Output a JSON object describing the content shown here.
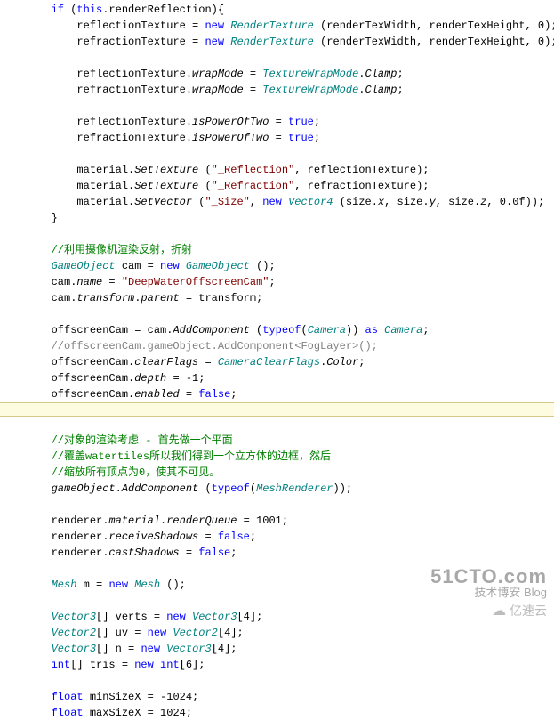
{
  "code": {
    "lines": [
      {
        "indent": 2,
        "tokens": [
          {
            "t": "kw",
            "v": "if"
          },
          {
            "t": "id",
            "v": " ("
          },
          {
            "t": "kw",
            "v": "this"
          },
          {
            "t": "id",
            "v": ".renderReflection){"
          }
        ]
      },
      {
        "indent": 3,
        "tokens": [
          {
            "t": "id",
            "v": "reflectionTexture = "
          },
          {
            "t": "kw",
            "v": "new"
          },
          {
            "t": "id",
            "v": " "
          },
          {
            "t": "type",
            "v": "RenderTexture"
          },
          {
            "t": "id",
            "v": " (renderTexWidth, renderTexHeight, 0);"
          }
        ]
      },
      {
        "indent": 3,
        "tokens": [
          {
            "t": "id",
            "v": "refractionTexture = "
          },
          {
            "t": "kw",
            "v": "new"
          },
          {
            "t": "id",
            "v": " "
          },
          {
            "t": "type",
            "v": "RenderTexture"
          },
          {
            "t": "id",
            "v": " (renderTexWidth, renderTexHeight, 0);"
          }
        ]
      },
      {
        "indent": 0,
        "tokens": []
      },
      {
        "indent": 3,
        "tokens": [
          {
            "t": "id",
            "v": "reflectionTexture."
          },
          {
            "t": "prop",
            "v": "wrapMode"
          },
          {
            "t": "id",
            "v": " = "
          },
          {
            "t": "type",
            "v": "TextureWrapMode"
          },
          {
            "t": "id",
            "v": "."
          },
          {
            "t": "prop",
            "v": "Clamp"
          },
          {
            "t": "id",
            "v": ";"
          }
        ]
      },
      {
        "indent": 3,
        "tokens": [
          {
            "t": "id",
            "v": "refractionTexture."
          },
          {
            "t": "prop",
            "v": "wrapMode"
          },
          {
            "t": "id",
            "v": " = "
          },
          {
            "t": "type",
            "v": "TextureWrapMode"
          },
          {
            "t": "id",
            "v": "."
          },
          {
            "t": "prop",
            "v": "Clamp"
          },
          {
            "t": "id",
            "v": ";"
          }
        ]
      },
      {
        "indent": 0,
        "tokens": []
      },
      {
        "indent": 3,
        "tokens": [
          {
            "t": "id",
            "v": "reflectionTexture."
          },
          {
            "t": "prop",
            "v": "isPowerOfTwo"
          },
          {
            "t": "id",
            "v": " = "
          },
          {
            "t": "kw",
            "v": "true"
          },
          {
            "t": "id",
            "v": ";"
          }
        ]
      },
      {
        "indent": 3,
        "tokens": [
          {
            "t": "id",
            "v": "refractionTexture."
          },
          {
            "t": "prop",
            "v": "isPowerOfTwo"
          },
          {
            "t": "id",
            "v": " = "
          },
          {
            "t": "kw",
            "v": "true"
          },
          {
            "t": "id",
            "v": ";"
          }
        ]
      },
      {
        "indent": 0,
        "tokens": []
      },
      {
        "indent": 3,
        "tokens": [
          {
            "t": "id",
            "v": "material."
          },
          {
            "t": "prop",
            "v": "SetTexture"
          },
          {
            "t": "id",
            "v": " ("
          },
          {
            "t": "str",
            "v": "\"_Reflection\""
          },
          {
            "t": "id",
            "v": ", reflectionTexture);"
          }
        ]
      },
      {
        "indent": 3,
        "tokens": [
          {
            "t": "id",
            "v": "material."
          },
          {
            "t": "prop",
            "v": "SetTexture"
          },
          {
            "t": "id",
            "v": " ("
          },
          {
            "t": "str",
            "v": "\"_Refraction\""
          },
          {
            "t": "id",
            "v": ", refractionTexture);"
          }
        ]
      },
      {
        "indent": 3,
        "tokens": [
          {
            "t": "id",
            "v": "material."
          },
          {
            "t": "prop",
            "v": "SetVector"
          },
          {
            "t": "id",
            "v": " ("
          },
          {
            "t": "str",
            "v": "\"_Size\""
          },
          {
            "t": "id",
            "v": ", "
          },
          {
            "t": "kw",
            "v": "new"
          },
          {
            "t": "id",
            "v": " "
          },
          {
            "t": "type",
            "v": "Vector4"
          },
          {
            "t": "id",
            "v": " (size."
          },
          {
            "t": "prop",
            "v": "x"
          },
          {
            "t": "id",
            "v": ", size."
          },
          {
            "t": "prop",
            "v": "y"
          },
          {
            "t": "id",
            "v": ", size."
          },
          {
            "t": "prop",
            "v": "z"
          },
          {
            "t": "id",
            "v": ", 0.0f));"
          }
        ]
      },
      {
        "indent": 2,
        "tokens": [
          {
            "t": "id",
            "v": "}"
          }
        ]
      },
      {
        "indent": 0,
        "tokens": []
      },
      {
        "indent": 2,
        "tokens": [
          {
            "t": "comment-g",
            "v": "//利用摄像机渲染反射，折射"
          }
        ]
      },
      {
        "indent": 2,
        "tokens": [
          {
            "t": "type",
            "v": "GameObject"
          },
          {
            "t": "id",
            "v": " cam = "
          },
          {
            "t": "kw",
            "v": "new"
          },
          {
            "t": "id",
            "v": " "
          },
          {
            "t": "type",
            "v": "GameObject"
          },
          {
            "t": "id",
            "v": " ();"
          }
        ]
      },
      {
        "indent": 2,
        "tokens": [
          {
            "t": "id",
            "v": "cam."
          },
          {
            "t": "prop",
            "v": "name"
          },
          {
            "t": "id",
            "v": " = "
          },
          {
            "t": "str",
            "v": "\"DeepWaterOffscreenCam\""
          },
          {
            "t": "id",
            "v": ";"
          }
        ]
      },
      {
        "indent": 2,
        "tokens": [
          {
            "t": "id",
            "v": "cam."
          },
          {
            "t": "prop",
            "v": "transform"
          },
          {
            "t": "id",
            "v": "."
          },
          {
            "t": "prop",
            "v": "parent"
          },
          {
            "t": "id",
            "v": " = transform;"
          }
        ]
      },
      {
        "indent": 0,
        "tokens": []
      },
      {
        "indent": 2,
        "tokens": [
          {
            "t": "id",
            "v": "offscreenCam = cam."
          },
          {
            "t": "prop",
            "v": "AddComponent"
          },
          {
            "t": "id",
            "v": " ("
          },
          {
            "t": "kw",
            "v": "typeof"
          },
          {
            "t": "id",
            "v": "("
          },
          {
            "t": "type",
            "v": "Camera"
          },
          {
            "t": "id",
            "v": ")) "
          },
          {
            "t": "kw",
            "v": "as"
          },
          {
            "t": "id",
            "v": " "
          },
          {
            "t": "type",
            "v": "Camera"
          },
          {
            "t": "id",
            "v": ";"
          }
        ]
      },
      {
        "indent": 2,
        "tokens": [
          {
            "t": "comment-grey",
            "v": "//offscreenCam.gameObject.AddComponent<FogLayer>();"
          }
        ]
      },
      {
        "indent": 2,
        "tokens": [
          {
            "t": "id",
            "v": "offscreenCam."
          },
          {
            "t": "prop",
            "v": "clearFlags"
          },
          {
            "t": "id",
            "v": " = "
          },
          {
            "t": "type",
            "v": "CameraClearFlags"
          },
          {
            "t": "id",
            "v": "."
          },
          {
            "t": "prop",
            "v": "Color"
          },
          {
            "t": "id",
            "v": ";"
          }
        ]
      },
      {
        "indent": 2,
        "tokens": [
          {
            "t": "id",
            "v": "offscreenCam."
          },
          {
            "t": "prop",
            "v": "depth"
          },
          {
            "t": "id",
            "v": " = -1;"
          }
        ]
      },
      {
        "indent": 2,
        "tokens": [
          {
            "t": "id",
            "v": "offscreenCam."
          },
          {
            "t": "prop",
            "v": "enabled"
          },
          {
            "t": "id",
            "v": " = "
          },
          {
            "t": "kw",
            "v": "false"
          },
          {
            "t": "id",
            "v": ";"
          }
        ]
      },
      {
        "indent": 0,
        "tokens": [],
        "hl": true
      },
      {
        "indent": 2,
        "tokens": [
          {
            "t": "comment-g",
            "v": "//对象的渲染考虑 - 首先做一个平面"
          }
        ]
      },
      {
        "indent": 2,
        "tokens": [
          {
            "t": "comment-g",
            "v": "//覆盖watertiles所以我们得到一个立方体的边框，然后"
          }
        ]
      },
      {
        "indent": 2,
        "tokens": [
          {
            "t": "comment-g",
            "v": "//缩放所有顶点为0，使其不可见。"
          }
        ]
      },
      {
        "indent": 2,
        "tokens": [
          {
            "t": "prop",
            "v": "gameObject"
          },
          {
            "t": "id",
            "v": "."
          },
          {
            "t": "prop",
            "v": "AddComponent"
          },
          {
            "t": "id",
            "v": " ("
          },
          {
            "t": "kw",
            "v": "typeof"
          },
          {
            "t": "id",
            "v": "("
          },
          {
            "t": "type",
            "v": "MeshRenderer"
          },
          {
            "t": "id",
            "v": "));"
          }
        ]
      },
      {
        "indent": 0,
        "tokens": []
      },
      {
        "indent": 2,
        "tokens": [
          {
            "t": "id",
            "v": "renderer."
          },
          {
            "t": "prop",
            "v": "material"
          },
          {
            "t": "id",
            "v": "."
          },
          {
            "t": "prop",
            "v": "renderQueue"
          },
          {
            "t": "id",
            "v": " = 1001;"
          }
        ]
      },
      {
        "indent": 2,
        "tokens": [
          {
            "t": "id",
            "v": "renderer."
          },
          {
            "t": "prop",
            "v": "receiveShadows"
          },
          {
            "t": "id",
            "v": " = "
          },
          {
            "t": "kw",
            "v": "false"
          },
          {
            "t": "id",
            "v": ";"
          }
        ]
      },
      {
        "indent": 2,
        "tokens": [
          {
            "t": "id",
            "v": "renderer."
          },
          {
            "t": "prop",
            "v": "castShadows"
          },
          {
            "t": "id",
            "v": " = "
          },
          {
            "t": "kw",
            "v": "false"
          },
          {
            "t": "id",
            "v": ";"
          }
        ]
      },
      {
        "indent": 0,
        "tokens": []
      },
      {
        "indent": 2,
        "tokens": [
          {
            "t": "type",
            "v": "Mesh"
          },
          {
            "t": "id",
            "v": " m = "
          },
          {
            "t": "kw",
            "v": "new"
          },
          {
            "t": "id",
            "v": " "
          },
          {
            "t": "type",
            "v": "Mesh"
          },
          {
            "t": "id",
            "v": " ();"
          }
        ]
      },
      {
        "indent": 0,
        "tokens": []
      },
      {
        "indent": 2,
        "tokens": [
          {
            "t": "type",
            "v": "Vector3"
          },
          {
            "t": "id",
            "v": "[] verts = "
          },
          {
            "t": "kw",
            "v": "new"
          },
          {
            "t": "id",
            "v": " "
          },
          {
            "t": "type",
            "v": "Vector3"
          },
          {
            "t": "id",
            "v": "[4];"
          }
        ]
      },
      {
        "indent": 2,
        "tokens": [
          {
            "t": "type",
            "v": "Vector2"
          },
          {
            "t": "id",
            "v": "[] uv = "
          },
          {
            "t": "kw",
            "v": "new"
          },
          {
            "t": "id",
            "v": " "
          },
          {
            "t": "type",
            "v": "Vector2"
          },
          {
            "t": "id",
            "v": "[4];"
          }
        ]
      },
      {
        "indent": 2,
        "tokens": [
          {
            "t": "type",
            "v": "Vector3"
          },
          {
            "t": "id",
            "v": "[] n = "
          },
          {
            "t": "kw",
            "v": "new"
          },
          {
            "t": "id",
            "v": " "
          },
          {
            "t": "type",
            "v": "Vector3"
          },
          {
            "t": "id",
            "v": "[4];"
          }
        ]
      },
      {
        "indent": 2,
        "tokens": [
          {
            "t": "kw",
            "v": "int"
          },
          {
            "t": "id",
            "v": "[] tris = "
          },
          {
            "t": "kw",
            "v": "new"
          },
          {
            "t": "id",
            "v": " "
          },
          {
            "t": "kw",
            "v": "int"
          },
          {
            "t": "id",
            "v": "[6];"
          }
        ]
      },
      {
        "indent": 0,
        "tokens": []
      },
      {
        "indent": 2,
        "tokens": [
          {
            "t": "kw",
            "v": "float"
          },
          {
            "t": "id",
            "v": " minSizeX = -1024;"
          }
        ]
      },
      {
        "indent": 2,
        "tokens": [
          {
            "t": "kw",
            "v": "float"
          },
          {
            "t": "id",
            "v": " maxSizeX = 1024;"
          }
        ]
      }
    ]
  },
  "watermark": {
    "line1": "51CTO.com",
    "line2": "技术博安  Blog",
    "line3": "亿速云"
  }
}
